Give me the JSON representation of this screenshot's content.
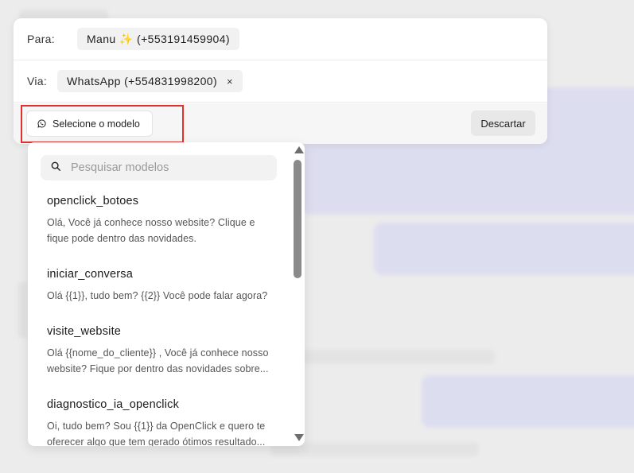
{
  "compose": {
    "to_label": "Para:",
    "to_value": "Manu ✨ (+553191459904)",
    "via_label": "Via:",
    "via_value": "WhatsApp (+554831998200)",
    "via_remove": "×",
    "select_model_label": "Selecione o modelo",
    "discard_label": "Descartar"
  },
  "templates": {
    "search_placeholder": "Pesquisar modelos",
    "items": [
      {
        "name": "openclick_botoes",
        "desc": "Olá, Você já conhece nosso website? Clique e fique pode dentro das novidades."
      },
      {
        "name": "iniciar_conversa",
        "desc": "Olá {{1}}, tudo bem? {{2}} Você pode falar agora?"
      },
      {
        "name": "visite_website",
        "desc_line1": "Olá {{nome_do_cliente}} , Você já conhece nosso",
        "desc_line2": "website? Fique por dentro das novidades sobre..."
      },
      {
        "name": "diagnostico_ia_openclick",
        "desc_line1": "Oi, tudo bem? Sou {{1}} da OpenClick e quero te",
        "desc_line2": "oferecer algo que tem gerado ótimos resultado..."
      }
    ]
  },
  "colors": {
    "highlight": "#e0312c",
    "bubble": "#dcdcf1",
    "page_bg": "#ececec"
  },
  "icons": {
    "whatsapp": "whatsapp-icon",
    "search": "search-icon",
    "close": "close-icon"
  }
}
